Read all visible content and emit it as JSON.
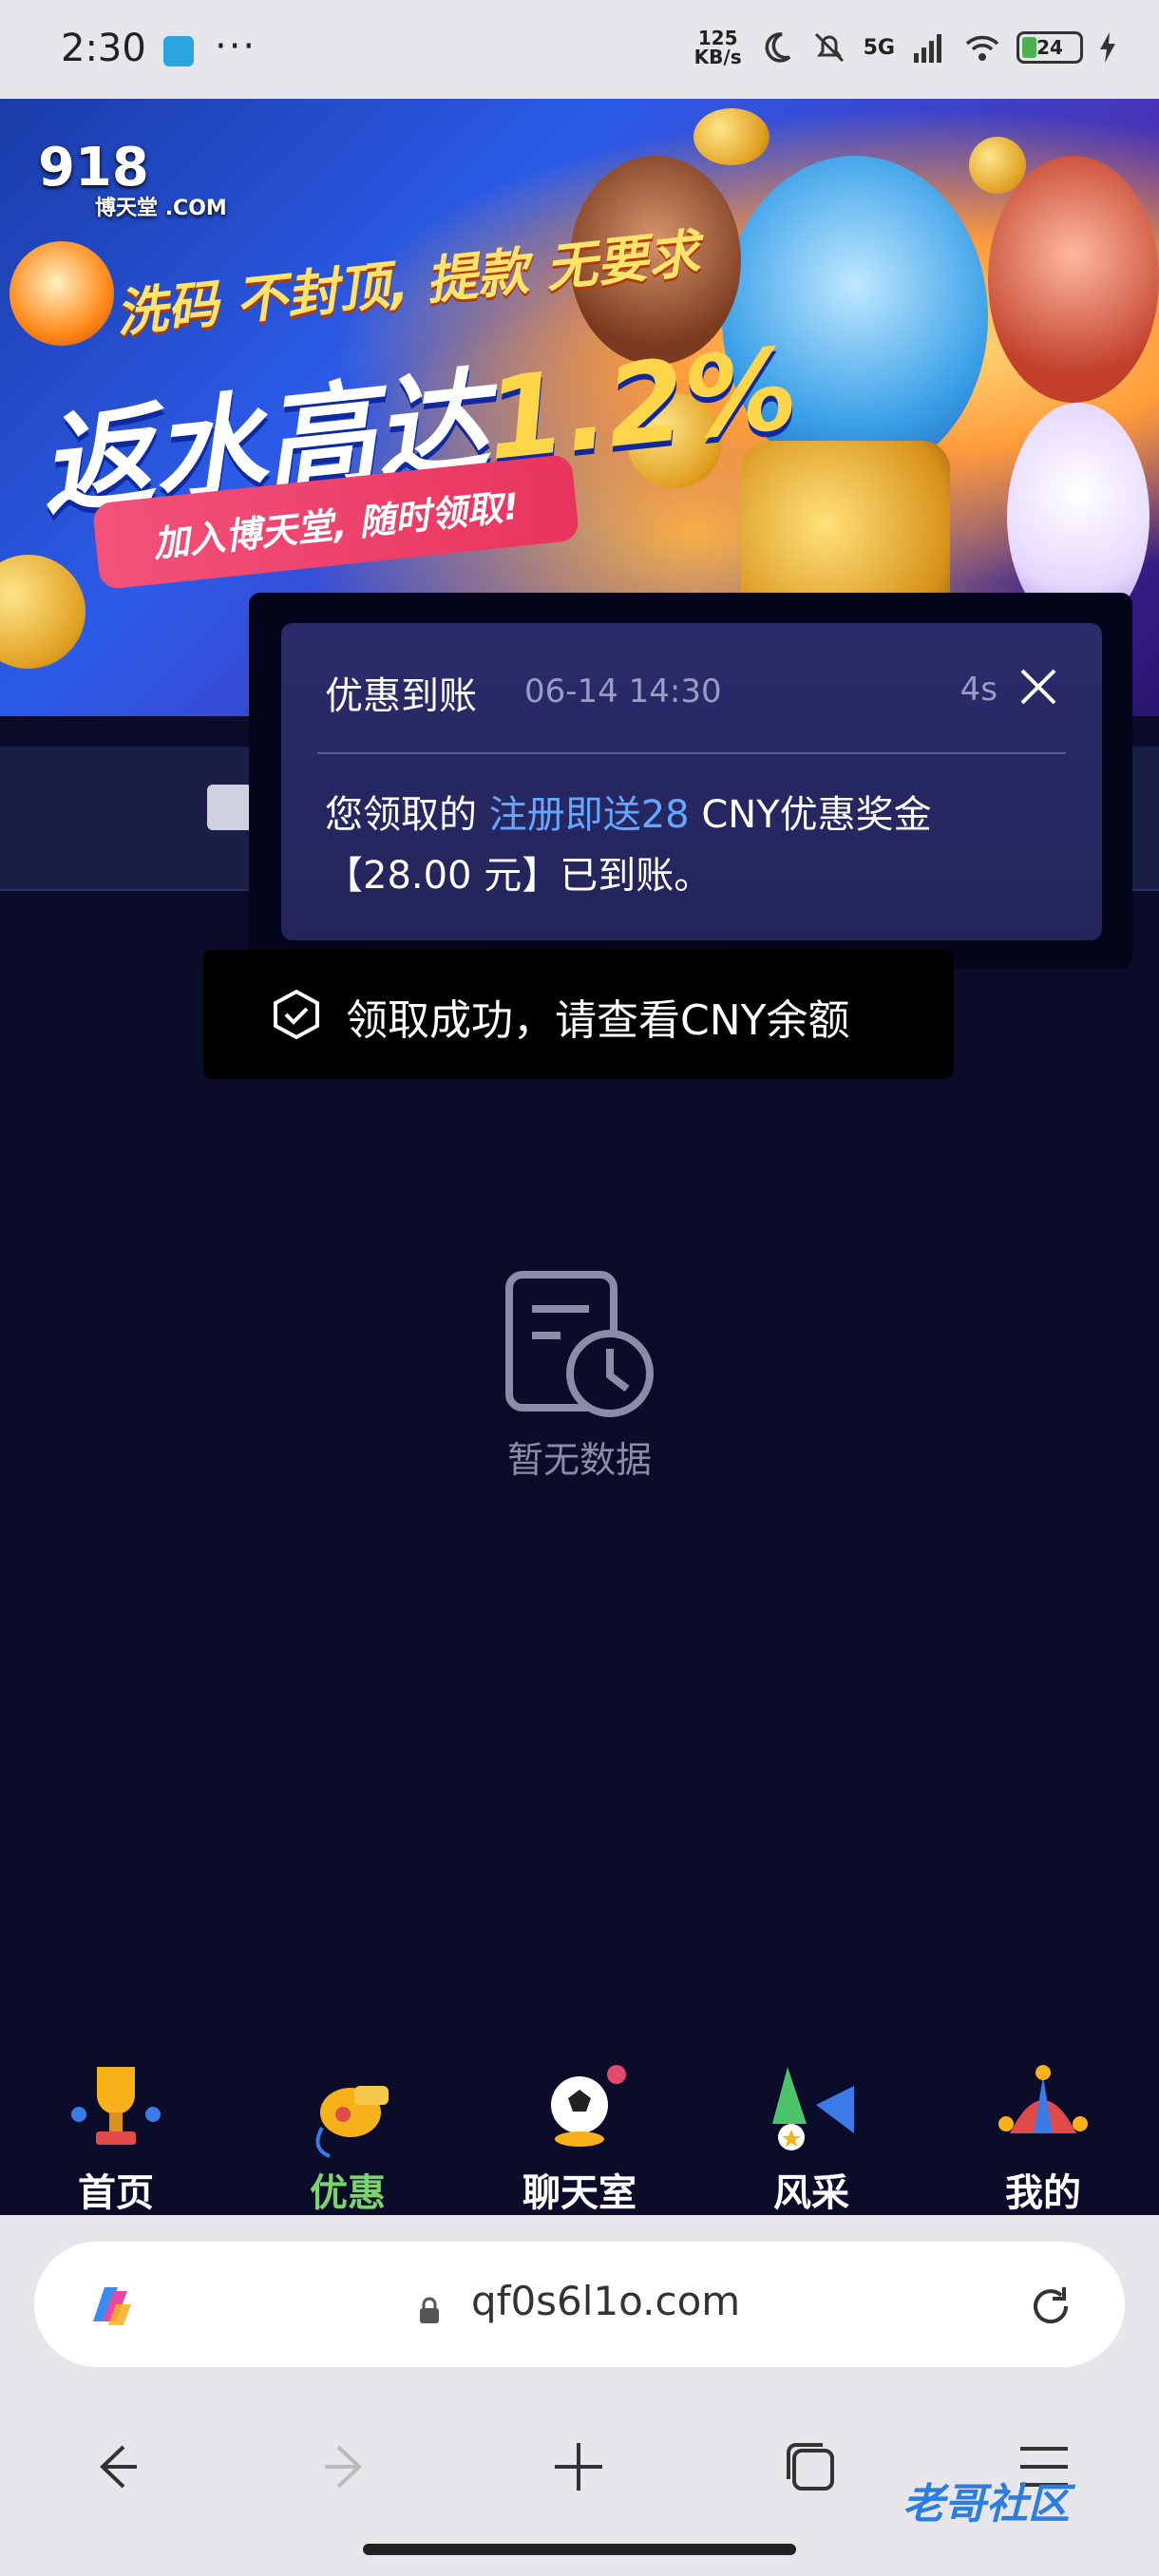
{
  "status_bar": {
    "time": "2:30",
    "more": "···",
    "speed_value": "125",
    "speed_unit": "KB/s",
    "network": "5G",
    "battery": "24"
  },
  "banner": {
    "logo": "918",
    "logo_sub": "博天堂",
    "logo_com": ".COM",
    "line1": "洗码 不封顶, 提款 无要求",
    "line2_prefix": "返水高达",
    "line2_rate": "1.2%",
    "pill": "加入博天堂, 随时领取!"
  },
  "notice": {
    "title": "优惠到账",
    "time": "06-14 14:30",
    "countdown": "4s",
    "body_prefix": "您领取的 ",
    "body_link": "注册即送28",
    "body_suffix": " CNY优惠奖金【28.00 元】已到账。"
  },
  "toast": {
    "text": "领取成功，请查看CNY余额"
  },
  "empty_state": {
    "text": "暂无数据"
  },
  "bottom_nav": {
    "items": [
      {
        "label": "首页"
      },
      {
        "label": "优惠"
      },
      {
        "label": "聊天室"
      },
      {
        "label": "风采"
      },
      {
        "label": "我的"
      }
    ],
    "active": "优惠"
  },
  "browser": {
    "url": "qf0s6l1o.com"
  },
  "watermark": "老哥社区",
  "colors": {
    "background": "#0b0c2a",
    "active_tab": "#7bd46b",
    "link": "#66a6ff"
  }
}
